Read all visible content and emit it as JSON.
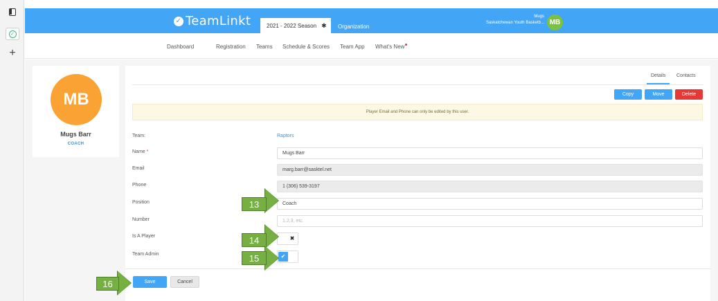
{
  "browser": {
    "rail_icons": [
      "panel-icon",
      "check-circle-icon",
      "plus-icon"
    ]
  },
  "header": {
    "logo_text": "TeamLinkt",
    "season_tab": "2021 - 2022 Season",
    "org_tab": "Organization",
    "user_name": "Mugs",
    "user_org": "Saskatchewan Youth Basketb...",
    "user_initials": "MB"
  },
  "nav": {
    "items": [
      "Dashboard",
      "Registration",
      "Teams",
      "Schedule & Scores",
      "Team App",
      "What's New"
    ]
  },
  "profile": {
    "initials": "MB",
    "name": "Mugs Barr",
    "role": "COACH"
  },
  "tabs": [
    "Details",
    "Contacts"
  ],
  "actions": {
    "copy": "Copy",
    "move": "Move",
    "delete": "Delete"
  },
  "notice": "Player Email and Phone can only be edited by this user.",
  "form": {
    "team_label": "Team:",
    "team_value": "Raptors",
    "name_label": "Name",
    "name_required": "*",
    "name_value": "Mugs Barr",
    "email_label": "Email",
    "email_value": "marg.barr@sasktel.net",
    "phone_label": "Phone",
    "phone_value": "1 (306) 539-3197",
    "position_label": "Position",
    "position_value": "Coach",
    "number_label": "Number",
    "number_placeholder": "1,2,3, etc.",
    "is_player_label": "Is A Player",
    "is_player": false,
    "team_admin_label": "Team Admin",
    "team_admin": true
  },
  "footer": {
    "save": "Save",
    "cancel": "Cancel"
  },
  "callouts": [
    "13",
    "14",
    "15",
    "16"
  ],
  "colors": {
    "primary": "#42a5f5",
    "danger": "#e53935",
    "avatar_large": "#fba234",
    "avatar_small": "#7cc242",
    "callout": "#76b043"
  }
}
